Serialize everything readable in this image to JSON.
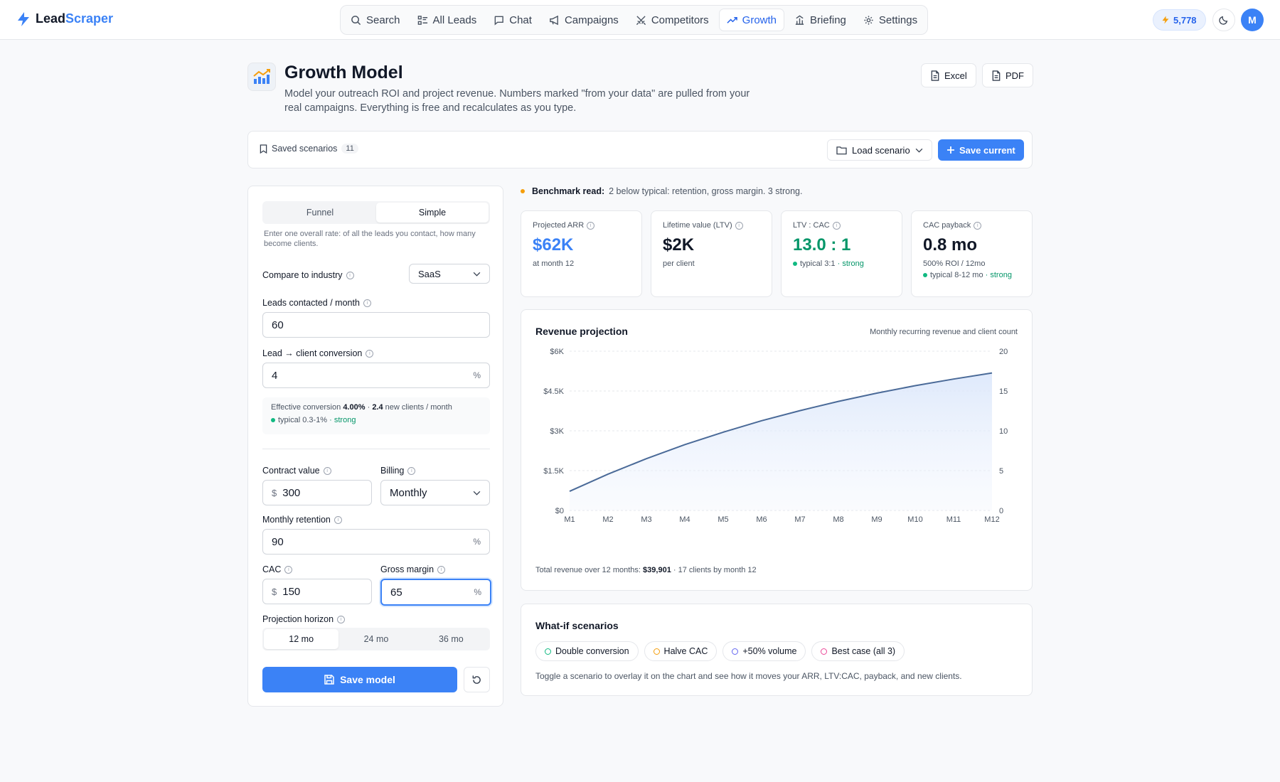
{
  "app": {
    "logo_left": "Lead",
    "logo_right": "Scraper"
  },
  "nav": [
    {
      "label": "Search",
      "icon": "search-icon"
    },
    {
      "label": "All Leads",
      "icon": "list-icon"
    },
    {
      "label": "Chat",
      "icon": "chat-icon"
    },
    {
      "label": "Campaigns",
      "icon": "megaphone-icon"
    },
    {
      "label": "Competitors",
      "icon": "swords-icon"
    },
    {
      "label": "Growth",
      "icon": "trending-up-icon",
      "active": true
    },
    {
      "label": "Briefing",
      "icon": "briefing-icon"
    },
    {
      "label": "Settings",
      "icon": "gear-icon"
    }
  ],
  "header": {
    "credits": "5,778",
    "avatar_initial": "M"
  },
  "page": {
    "title": "Growth Model",
    "subtitle": "Model your outreach ROI and project revenue. Numbers marked \"from your data\" are pulled from your real campaigns. Everything is free and recalculates as you type.",
    "export_excel": "Excel",
    "export_pdf": "PDF"
  },
  "scenarios": {
    "label": "Saved scenarios",
    "count": "11",
    "load_label": "Load scenario",
    "save_label": "Save current"
  },
  "form": {
    "mode_tabs": [
      "Funnel",
      "Simple"
    ],
    "active_mode": "Simple",
    "helper": "Enter one overall rate: of all the leads you contact, how many become clients.",
    "industry_label": "Compare to industry",
    "industry_value": "SaaS",
    "leads_label": "Leads contacted / month",
    "leads_value": "60",
    "conversion_label": "Lead → client conversion",
    "conversion_value": "4",
    "percent": "%",
    "dollar": "$",
    "effective": {
      "prefix": "Effective conversion",
      "rate": "4.00%",
      "sep": "·",
      "clients": "2.4",
      "suffix": "new clients / month",
      "typical": "typical 0.3-1%",
      "rating": "· strong"
    },
    "contract_label": "Contract value",
    "contract_value": "300",
    "billing_label": "Billing",
    "billing_value": "Monthly",
    "retention_label": "Monthly retention",
    "retention_value": "90",
    "cac_label": "CAC",
    "cac_value": "150",
    "margin_label": "Gross margin",
    "margin_value": "65",
    "horizon_label": "Projection horizon",
    "horizon_options": [
      "12 mo",
      "24 mo",
      "36 mo"
    ],
    "save_model": "Save model"
  },
  "benchmark": {
    "label": "Benchmark read:",
    "text": "2 below typical: retention, gross margin. 3 strong."
  },
  "kpis": [
    {
      "label": "Projected ARR",
      "value": "$62K",
      "sub": "at month 12",
      "color": "#3b82f6"
    },
    {
      "label": "Lifetime value (LTV)",
      "value": "$2K",
      "sub": "per client",
      "color": "#111827"
    },
    {
      "label": "LTV : CAC",
      "value": "13.0 : 1",
      "typical": "typical 3:1",
      "rating": "· strong",
      "color": "#059669"
    },
    {
      "label": "CAC payback",
      "value": "0.8 mo",
      "sub": "500% ROI / 12mo",
      "typical": "typical 8-12 mo",
      "rating": "· strong",
      "color": "#111827"
    }
  ],
  "chart_data": {
    "type": "area",
    "title": "Revenue projection",
    "legend": "Monthly recurring revenue and client count",
    "x": [
      "M1",
      "M2",
      "M3",
      "M4",
      "M5",
      "M6",
      "M7",
      "M8",
      "M9",
      "M10",
      "M11",
      "M12"
    ],
    "y_left_ticks": [
      "$0",
      "$1.5K",
      "$3K",
      "$4.5K",
      "$6K"
    ],
    "y_right_ticks": [
      "0",
      "5",
      "10",
      "15",
      "20"
    ],
    "ylim": [
      0,
      6000
    ],
    "series": [
      {
        "values": [
          720,
          1370,
          1950,
          2480,
          2950,
          3380,
          3760,
          4110,
          4420,
          4700,
          4950,
          5180
        ]
      }
    ],
    "grid": true
  },
  "chart_footer": {
    "prefix": "Total revenue over 12 months:",
    "total": "$39,901",
    "suffix": "· 17 clients by month 12"
  },
  "whatif": {
    "title": "What-if scenarios",
    "chips": [
      {
        "label": "Double conversion",
        "color": "#10b981"
      },
      {
        "label": "Halve CAC",
        "color": "#f59e0b"
      },
      {
        "label": "+50% volume",
        "color": "#6366f1"
      },
      {
        "label": "Best case (all 3)",
        "color": "#ec4899"
      }
    ],
    "help": "Toggle a scenario to overlay it on the chart and see how it moves your ARR, LTV:CAC, payback, and new clients."
  }
}
